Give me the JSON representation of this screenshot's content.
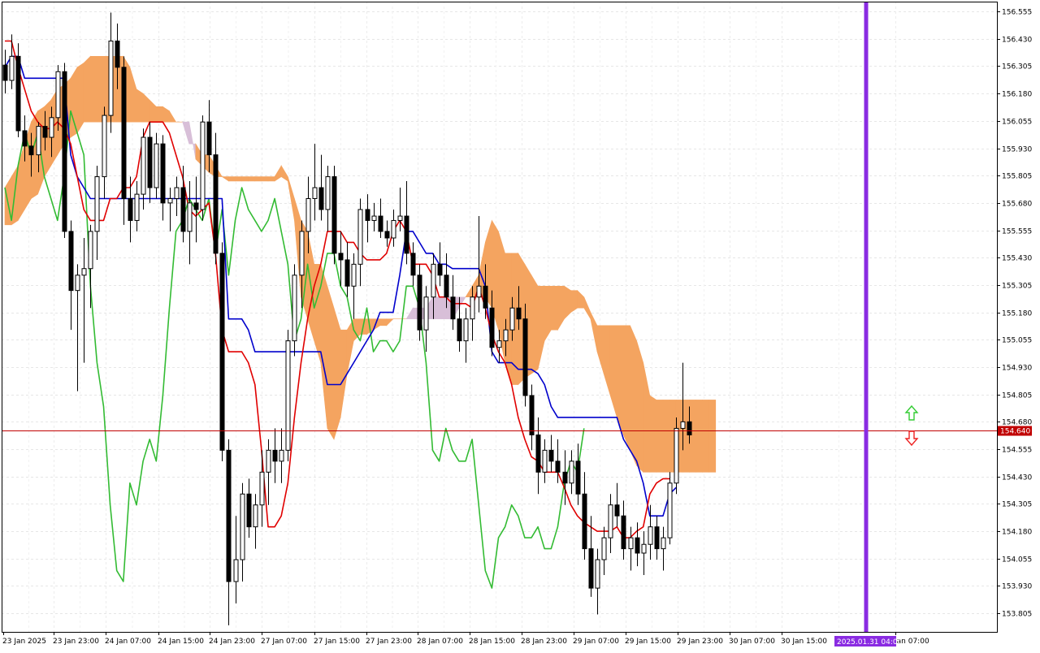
{
  "chart_data": {
    "type": "candlestick",
    "indicator": "Ichimoku Kinko Hyo",
    "y_axis": {
      "min": 153.72,
      "max": 156.6,
      "ticks": [
        "156.555",
        "156.430",
        "156.305",
        "156.180",
        "156.055",
        "155.930",
        "155.805",
        "155.680",
        "155.555",
        "155.430",
        "155.305",
        "155.180",
        "155.055",
        "154.930",
        "154.805",
        "154.680",
        "154.555",
        "154.430",
        "154.305",
        "154.180",
        "154.055",
        "153.930",
        "153.805"
      ]
    },
    "x_axis": {
      "ticks": [
        "23 Jan 2025",
        "23 Jan 23:00",
        "24 Jan 07:00",
        "24 Jan 15:00",
        "24 Jan 23:00",
        "27 Jan 07:00",
        "27 Jan 15:00",
        "27 Jan 23:00",
        "28 Jan 07:00",
        "28 Jan 15:00",
        "28 Jan 23:00",
        "29 Jan 07:00",
        "29 Jan 15:00",
        "29 Jan 23:00",
        "30 Jan 07:00",
        "30 Jan 15:00",
        "Jan 07:00"
      ],
      "highlight_label": "2025.01.31 04:00"
    },
    "current_price": 154.64,
    "current_price_label": "154.640",
    "grid": true,
    "colors": {
      "tenkan": "#e00000",
      "kijun": "#0000cc",
      "chikou": "#33bb33",
      "kumo_bull": "#f4a460",
      "kumo_bear": "#d8bfd8",
      "price_line": "#c00000",
      "cursor": "#8a2be2",
      "bull_candle": "#ffffff",
      "bear_candle": "#000000",
      "arrow_up": "#33cc33",
      "arrow_down": "#ee2222"
    },
    "candles": [
      [
        156.31,
        156.38,
        156.18,
        156.24
      ],
      [
        156.24,
        156.45,
        156.2,
        156.35
      ],
      [
        156.35,
        156.41,
        155.98,
        156.01
      ],
      [
        156.01,
        156.08,
        155.87,
        155.94
      ],
      [
        155.94,
        156.0,
        155.8,
        155.9
      ],
      [
        155.9,
        156.05,
        155.82,
        156.03
      ],
      [
        156.03,
        156.1,
        155.92,
        155.98
      ],
      [
        155.98,
        156.12,
        155.89,
        156.07
      ],
      [
        156.07,
        156.31,
        156.01,
        156.28
      ],
      [
        156.28,
        156.32,
        155.52,
        155.55
      ],
      [
        155.55,
        155.6,
        155.1,
        155.28
      ],
      [
        155.28,
        155.4,
        154.82,
        155.35
      ],
      [
        155.35,
        155.52,
        154.95,
        155.38
      ],
      [
        155.38,
        155.58,
        155.2,
        155.55
      ],
      [
        155.55,
        155.85,
        155.42,
        155.8
      ],
      [
        155.8,
        156.12,
        155.7,
        156.08
      ],
      [
        156.08,
        156.55,
        156.0,
        156.42
      ],
      [
        156.42,
        156.5,
        156.2,
        156.3
      ],
      [
        156.3,
        156.35,
        155.58,
        155.7
      ],
      [
        155.7,
        155.8,
        155.5,
        155.6
      ],
      [
        155.6,
        155.78,
        155.55,
        155.72
      ],
      [
        155.72,
        156.02,
        155.65,
        155.98
      ],
      [
        155.98,
        156.05,
        155.68,
        155.75
      ],
      [
        155.75,
        156.0,
        155.7,
        155.95
      ],
      [
        155.95,
        155.99,
        155.6,
        155.68
      ],
      [
        155.68,
        155.75,
        155.55,
        155.7
      ],
      [
        155.7,
        155.8,
        155.62,
        155.75
      ],
      [
        155.75,
        155.85,
        155.5,
        155.55
      ],
      [
        155.55,
        155.78,
        155.4,
        155.68
      ],
      [
        155.68,
        155.8,
        155.5,
        155.65
      ],
      [
        155.65,
        156.08,
        155.6,
        156.05
      ],
      [
        156.05,
        156.15,
        155.82,
        155.9
      ],
      [
        155.9,
        156.0,
        155.4,
        155.45
      ],
      [
        155.45,
        155.5,
        154.5,
        154.55
      ],
      [
        154.55,
        154.6,
        153.75,
        153.95
      ],
      [
        153.95,
        154.25,
        153.85,
        154.05
      ],
      [
        154.05,
        154.4,
        153.95,
        154.35
      ],
      [
        154.35,
        154.42,
        154.15,
        154.2
      ],
      [
        154.2,
        154.35,
        154.1,
        154.3
      ],
      [
        154.3,
        154.55,
        154.2,
        154.45
      ],
      [
        154.45,
        154.6,
        154.3,
        154.55
      ],
      [
        154.55,
        154.65,
        154.4,
        154.5
      ],
      [
        154.5,
        154.65,
        154.4,
        154.55
      ],
      [
        154.55,
        155.1,
        154.5,
        155.05
      ],
      [
        155.05,
        155.4,
        154.98,
        155.35
      ],
      [
        155.35,
        155.6,
        155.2,
        155.55
      ],
      [
        155.55,
        155.8,
        155.45,
        155.7
      ],
      [
        155.7,
        155.95,
        155.6,
        155.75
      ],
      [
        155.75,
        155.9,
        155.6,
        155.65
      ],
      [
        155.65,
        155.85,
        155.55,
        155.8
      ],
      [
        155.8,
        155.85,
        155.4,
        155.45
      ],
      [
        155.45,
        155.55,
        155.3,
        155.42
      ],
      [
        155.42,
        155.5,
        155.25,
        155.3
      ],
      [
        155.3,
        155.45,
        155.15,
        155.4
      ],
      [
        155.4,
        155.7,
        155.3,
        155.65
      ],
      [
        155.65,
        155.72,
        155.5,
        155.6
      ],
      [
        155.6,
        155.68,
        155.55,
        155.62
      ],
      [
        155.62,
        155.7,
        155.52,
        155.55
      ],
      [
        155.55,
        155.6,
        155.48,
        155.52
      ],
      [
        155.52,
        155.65,
        155.48,
        155.6
      ],
      [
        155.6,
        155.75,
        155.55,
        155.62
      ],
      [
        155.62,
        155.78,
        155.4,
        155.45
      ],
      [
        155.45,
        155.5,
        155.3,
        155.35
      ],
      [
        155.35,
        155.4,
        155.05,
        155.1
      ],
      [
        155.1,
        155.3,
        155.0,
        155.25
      ],
      [
        155.25,
        155.45,
        155.15,
        155.4
      ],
      [
        155.4,
        155.5,
        155.3,
        155.35
      ],
      [
        155.35,
        155.45,
        155.2,
        155.25
      ],
      [
        155.25,
        155.35,
        155.1,
        155.15
      ],
      [
        155.15,
        155.25,
        155.0,
        155.05
      ],
      [
        155.05,
        155.2,
        154.95,
        155.15
      ],
      [
        155.15,
        155.3,
        155.05,
        155.25
      ],
      [
        155.25,
        155.62,
        155.18,
        155.3
      ],
      [
        155.3,
        155.4,
        155.15,
        155.2
      ],
      [
        155.2,
        155.28,
        154.98,
        155.02
      ],
      [
        155.02,
        155.1,
        154.95,
        155.05
      ],
      [
        155.05,
        155.15,
        154.98,
        155.1
      ],
      [
        155.1,
        155.25,
        155.05,
        155.2
      ],
      [
        155.2,
        155.3,
        155.1,
        155.15
      ],
      [
        155.15,
        155.22,
        154.75,
        154.8
      ],
      [
        154.8,
        154.85,
        154.55,
        154.62
      ],
      [
        154.62,
        154.7,
        154.35,
        154.45
      ],
      [
        154.45,
        154.6,
        154.4,
        154.55
      ],
      [
        154.55,
        154.62,
        154.45,
        154.5
      ],
      [
        154.5,
        154.6,
        154.4,
        154.45
      ],
      [
        154.45,
        154.55,
        154.3,
        154.4
      ],
      [
        154.4,
        154.55,
        154.35,
        154.5
      ],
      [
        154.5,
        154.58,
        154.3,
        154.35
      ],
      [
        154.35,
        154.45,
        154.05,
        154.1
      ],
      [
        154.1,
        154.25,
        153.88,
        153.92
      ],
      [
        153.92,
        154.1,
        153.8,
        154.05
      ],
      [
        154.05,
        154.2,
        153.98,
        154.15
      ],
      [
        154.15,
        154.35,
        154.08,
        154.3
      ],
      [
        154.3,
        154.4,
        154.2,
        154.25
      ],
      [
        154.25,
        154.32,
        154.05,
        154.1
      ],
      [
        154.1,
        154.2,
        154.0,
        154.15
      ],
      [
        154.15,
        154.22,
        154.02,
        154.08
      ],
      [
        154.08,
        154.18,
        153.98,
        154.12
      ],
      [
        154.12,
        154.3,
        154.05,
        154.2
      ],
      [
        154.2,
        154.25,
        154.05,
        154.1
      ],
      [
        154.1,
        154.2,
        154.0,
        154.15
      ],
      [
        154.15,
        154.45,
        154.12,
        154.4
      ],
      [
        154.4,
        154.7,
        154.35,
        154.65
      ],
      [
        154.65,
        154.95,
        154.55,
        154.68
      ],
      [
        154.68,
        154.75,
        154.58,
        154.62
      ]
    ],
    "tenkan": [
      156.42,
      156.42,
      156.3,
      156.2,
      156.1,
      156.05,
      156.02,
      156.02,
      156.05,
      156.02,
      155.95,
      155.8,
      155.65,
      155.6,
      155.6,
      155.6,
      155.7,
      155.7,
      155.75,
      155.75,
      155.8,
      155.98,
      156.05,
      156.05,
      156.05,
      156.0,
      155.9,
      155.8,
      155.65,
      155.62,
      155.65,
      155.68,
      155.45,
      155.1,
      155.0,
      155.0,
      155.0,
      154.95,
      154.85,
      154.55,
      154.2,
      154.2,
      154.25,
      154.4,
      154.7,
      154.95,
      155.15,
      155.3,
      155.4,
      155.55,
      155.55,
      155.55,
      155.5,
      155.5,
      155.45,
      155.42,
      155.42,
      155.42,
      155.45,
      155.55,
      155.6,
      155.55,
      155.4,
      155.4,
      155.4,
      155.35,
      155.25,
      155.25,
      155.22,
      155.22,
      155.22,
      155.2,
      155.3,
      155.2,
      155.08,
      155.0,
      154.95,
      154.85,
      154.7,
      154.6,
      154.52,
      154.5,
      154.45,
      154.45,
      154.45,
      154.38,
      154.3,
      154.25,
      154.22,
      154.2,
      154.18,
      154.18,
      154.18,
      154.2,
      154.15,
      154.15,
      154.18,
      154.2,
      154.35,
      154.4,
      154.42,
      154.42
    ],
    "kijun": [
      156.3,
      156.35,
      156.35,
      156.25,
      156.25,
      156.25,
      156.25,
      156.25,
      156.25,
      156.25,
      155.9,
      155.8,
      155.75,
      155.7,
      155.7,
      155.7,
      155.7,
      155.7,
      155.7,
      155.7,
      155.7,
      155.7,
      155.7,
      155.7,
      155.7,
      155.7,
      155.7,
      155.7,
      155.7,
      155.7,
      155.7,
      155.7,
      155.7,
      155.7,
      155.15,
      155.15,
      155.15,
      155.1,
      155.0,
      155.0,
      155.0,
      155.0,
      155.0,
      155.0,
      155.0,
      155.0,
      155.0,
      155.0,
      155.0,
      154.85,
      154.85,
      154.85,
      154.9,
      154.95,
      155.0,
      155.05,
      155.1,
      155.18,
      155.18,
      155.18,
      155.35,
      155.55,
      155.55,
      155.5,
      155.45,
      155.45,
      155.4,
      155.4,
      155.38,
      155.38,
      155.38,
      155.38,
      155.38,
      155.3,
      155.0,
      154.95,
      154.95,
      154.95,
      154.92,
      154.92,
      154.92,
      154.9,
      154.85,
      154.75,
      154.7,
      154.7,
      154.7,
      154.7,
      154.7,
      154.7,
      154.7,
      154.7,
      154.7,
      154.7,
      154.6,
      154.55,
      154.5,
      154.4,
      154.25,
      154.25,
      154.25,
      154.35,
      154.38
    ],
    "chikou": [
      155.75,
      155.6,
      155.85,
      156.0,
      155.9,
      156.0,
      155.8,
      155.7,
      155.6,
      155.8,
      156.1,
      156.0,
      155.9,
      155.3,
      154.95,
      154.75,
      154.3,
      154.0,
      153.95,
      154.4,
      154.3,
      154.5,
      154.6,
      154.5,
      154.8,
      155.2,
      155.55,
      155.6,
      155.7,
      155.65,
      155.6,
      155.7,
      155.45,
      155.65,
      155.35,
      155.6,
      155.75,
      155.65,
      155.6,
      155.55,
      155.6,
      155.7,
      155.55,
      155.4,
      155.05,
      155.15,
      155.4,
      155.2,
      155.3,
      155.45,
      155.45,
      155.3,
      155.25,
      155.1,
      155.05,
      155.2,
      155.0,
      155.05,
      155.05,
      155.0,
      155.05,
      155.3,
      155.3,
      155.2,
      154.95,
      154.55,
      154.5,
      154.65,
      154.55,
      154.5,
      154.5,
      154.6,
      154.3,
      154.0,
      153.92,
      154.15,
      154.2,
      154.3,
      154.25,
      154.15,
      154.15,
      154.2,
      154.1,
      154.1,
      154.2,
      154.4,
      154.5,
      154.45,
      154.65
    ],
    "kumo_a": [
      155.75,
      155.8,
      155.85,
      155.95,
      156.05,
      156.1,
      156.12,
      156.15,
      156.2,
      156.22,
      156.25,
      156.3,
      156.32,
      156.35,
      156.35,
      156.35,
      156.35,
      156.35,
      156.35,
      156.3,
      156.2,
      156.18,
      156.15,
      156.12,
      156.12,
      156.1,
      156.05,
      156.05,
      155.95,
      155.95,
      155.9,
      155.9,
      155.85,
      155.8,
      155.8,
      155.8,
      155.8,
      155.8,
      155.8,
      155.8,
      155.8,
      155.8,
      155.85,
      155.8,
      155.7,
      155.6,
      155.55,
      155.4,
      155.4,
      155.3,
      155.2,
      155.1,
      155.1,
      155.15,
      155.15,
      155.15,
      155.15,
      155.15,
      155.15,
      155.15,
      155.15,
      155.15,
      155.15,
      155.15,
      155.15,
      155.15,
      155.15,
      155.15,
      155.15,
      155.2,
      155.25,
      155.3,
      155.35,
      155.5,
      155.6,
      155.55,
      155.45,
      155.45,
      155.45,
      155.4,
      155.35,
      155.3,
      155.3,
      155.3,
      155.3,
      155.3,
      155.28,
      155.28,
      155.25,
      155.18,
      155.12,
      155.12,
      155.12,
      155.12,
      155.12,
      155.12,
      155.05,
      154.95,
      154.8,
      154.78,
      154.78,
      154.78,
      154.78,
      154.78,
      154.78,
      154.78,
      154.78,
      154.78,
      154.78
    ],
    "kumo_b": [
      155.58,
      155.58,
      155.6,
      155.65,
      155.7,
      155.72,
      155.8,
      155.85,
      155.9,
      155.95,
      155.98,
      156.0,
      156.05,
      156.05,
      156.05,
      156.05,
      156.05,
      156.05,
      156.05,
      156.05,
      156.05,
      156.05,
      156.05,
      156.05,
      156.05,
      156.05,
      156.05,
      156.05,
      156.05,
      155.88,
      155.85,
      155.82,
      155.8,
      155.8,
      155.78,
      155.78,
      155.78,
      155.78,
      155.78,
      155.78,
      155.78,
      155.78,
      155.8,
      155.78,
      155.6,
      155.25,
      155.15,
      155.05,
      154.95,
      154.65,
      154.6,
      154.7,
      154.9,
      155.05,
      155.08,
      155.08,
      155.1,
      155.12,
      155.12,
      155.15,
      155.15,
      155.15,
      155.2,
      155.2,
      155.2,
      155.25,
      155.25,
      155.25,
      155.25,
      155.25,
      155.25,
      155.25,
      155.25,
      155.25,
      155.2,
      155.1,
      154.95,
      154.85,
      154.85,
      154.88,
      154.9,
      154.92,
      155.05,
      155.1,
      155.1,
      155.15,
      155.18,
      155.2,
      155.2,
      155.15,
      155.0,
      154.9,
      154.8,
      154.7,
      154.62,
      154.55,
      154.48,
      154.45,
      154.45,
      154.45,
      154.45,
      154.45,
      154.45,
      154.45,
      154.45,
      154.45,
      154.45,
      154.45,
      154.45
    ]
  }
}
